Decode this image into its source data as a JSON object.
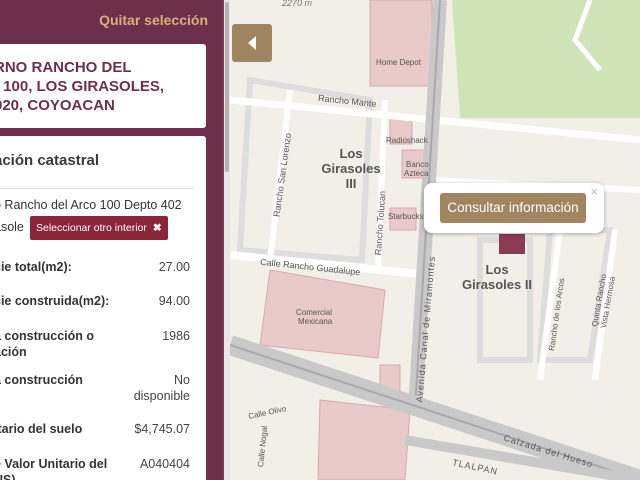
{
  "panel": {
    "quitar": "Quitar selección",
    "title": "RNO RANCHO DEL\n) 100, LOS GIRASOLES,\n920, COYOACAN",
    "info_header": "ación catastral",
    "address_line1": "o Rancho del Arco 100 Depto 402",
    "address_line2": "asole",
    "select_button": "Seleccionar otro interior",
    "rows": [
      {
        "label": "cie total(m2):",
        "value": "27.00"
      },
      {
        "label": "cie construida(m2):",
        "value": "94.00"
      },
      {
        "label": "a construcción o\nación",
        "value": "1986"
      },
      {
        "label": "a construcción",
        "value": "No\ndisponible"
      },
      {
        "label": "itario del suelo",
        "value": "$4,745.07"
      },
      {
        "label": "e Valor Unitario del\nUS)",
        "value": "A040404"
      }
    ]
  },
  "map": {
    "labels": {
      "scale": "2270 m",
      "home_depot": "Home Depot",
      "radioshack": "Radioshack",
      "banco1": "Banco",
      "banco2": "Azteca",
      "starbucks": "Starbucks",
      "comercial1": "Comercial",
      "comercial2": "Mexicana",
      "rancho_mante": "Rancho Mante",
      "rancho_san_lorenzo": "Rancho San Lorenzo",
      "rancho_tolucan": "Rancho Tolucan",
      "calle_guadalupe": "Calle Rancho Guadalupe",
      "avenida": "Avenida Canal de Miramontes",
      "rancho_arcos": "Rancho de los Arcos",
      "quinta_hermosa": "Quinta Rancho Vista Hermosa",
      "calzada": "Calzada del Hueso",
      "tlalpan": "TLALPAN",
      "calle_olivo": "Calle Olivo",
      "nogal": "Calle Nogal",
      "girasoles3_a": "Los",
      "girasoles3_b": "Girasoles",
      "girasoles3_c": "III",
      "girasoles2_a": "Los",
      "girasoles2_b": "Girasoles II"
    },
    "popup_button": "Consultar información",
    "popup_close": "×"
  },
  "colors": {
    "accent": "#a08560",
    "brand": "#6e2f4c",
    "select_btn": "#8a2637"
  }
}
